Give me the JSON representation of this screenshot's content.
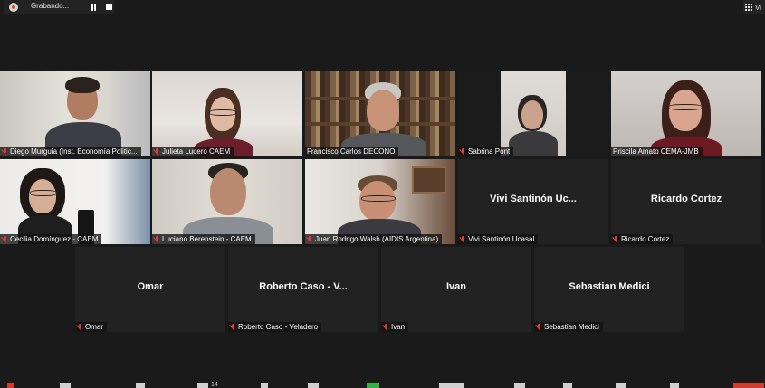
{
  "recording": {
    "label": "Grabando..."
  },
  "view": {
    "label": "Vi"
  },
  "participants": [
    {
      "label": "Diego Murguia (Inst. Economía Politic..."
    },
    {
      "label": "Julieta Lucero CAEM"
    },
    {
      "label": "Francisco Carlos DECONO"
    },
    {
      "label": "Sabrina Pont"
    },
    {
      "label": "Priscila Amato CEMA-JMB"
    },
    {
      "label": "Cecilia Domínguez - CAEM"
    },
    {
      "label": "Luciano Berenstein - CAEM"
    },
    {
      "label": "Juan Rodrigo Walsh (AIDIS Argentina)"
    },
    {
      "label": "Vivi Santinón Ucasal",
      "center": "Vivi Santinón Uc..."
    },
    {
      "label": "Ricardo Cortez",
      "center": "Ricardo Cortez"
    },
    {
      "label": "Omar",
      "center": "Omar"
    },
    {
      "label": "Roberto Caso - Veladero",
      "center": "Roberto Caso - V..."
    },
    {
      "label": "Ivan",
      "center": "Ivan"
    },
    {
      "label": "Sebastian Medici",
      "center": "Sebastian Medici"
    }
  ],
  "toolbar": {
    "participants_count": "14"
  },
  "colors": {
    "active_speaker_border": "#d7e85a",
    "muted_icon": "#e23a3a",
    "background": "#1a1a1a"
  }
}
